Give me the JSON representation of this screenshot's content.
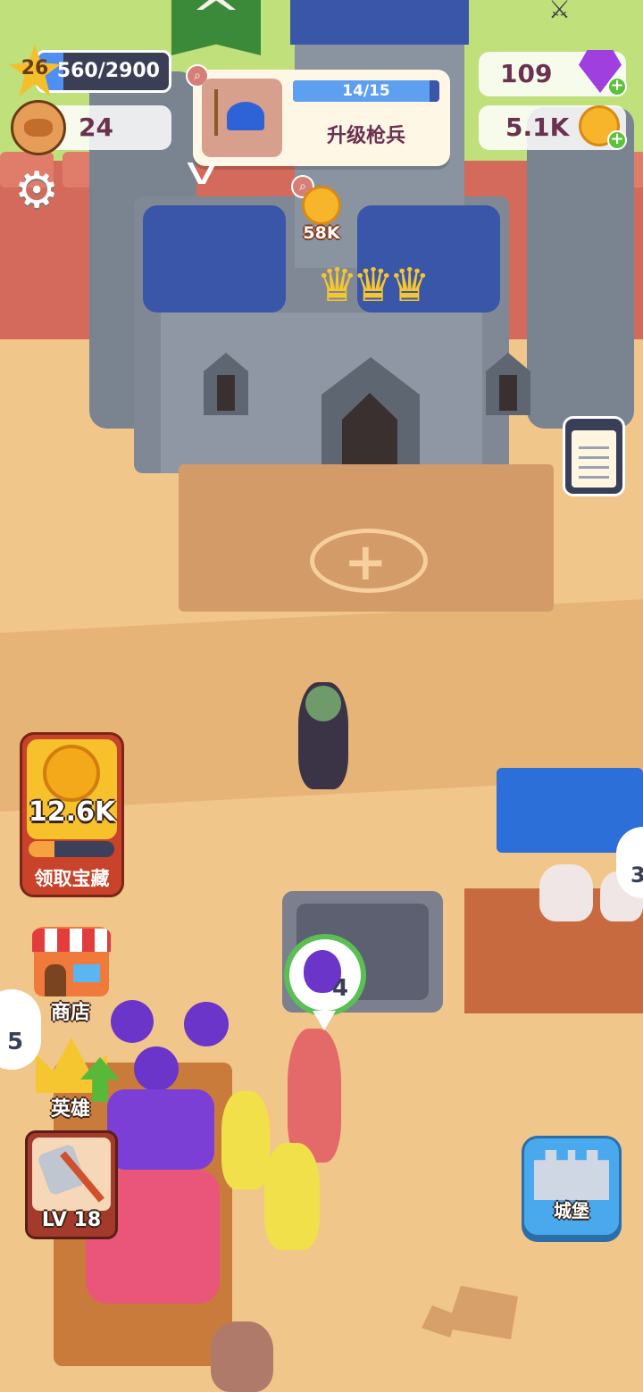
{
  "hud": {
    "level": "26",
    "xp_text": "560/2900",
    "xp_progress": 0.19,
    "population": "24",
    "gems": "109",
    "coins": "5.1K"
  },
  "quest": {
    "progress_text": "14/15",
    "progress": 0.93,
    "title": "升级枪兵"
  },
  "castle_upgrade": {
    "cost": "58K"
  },
  "treasure": {
    "amount": "12.6K",
    "progress": 0.3,
    "label": "领取宝藏"
  },
  "side_menu": {
    "shop_label": "商店",
    "hero_label": "英雄",
    "weapon_level": "LV 18"
  },
  "castle_button": {
    "label": "城堡"
  },
  "bubbles": {
    "berry_count": "4",
    "left_count": "5",
    "right_count": "3"
  },
  "colors": {
    "accent_blue": "#3a56a8",
    "grass": "#bfe07a",
    "sand": "#f0c68b",
    "text_purple": "#6a3150"
  },
  "icons": {
    "settings": "gear-icon",
    "gem": "gem-icon",
    "coin": "coin-icon",
    "quest": "spearman-icon",
    "clipboard": "task-list-icon"
  }
}
